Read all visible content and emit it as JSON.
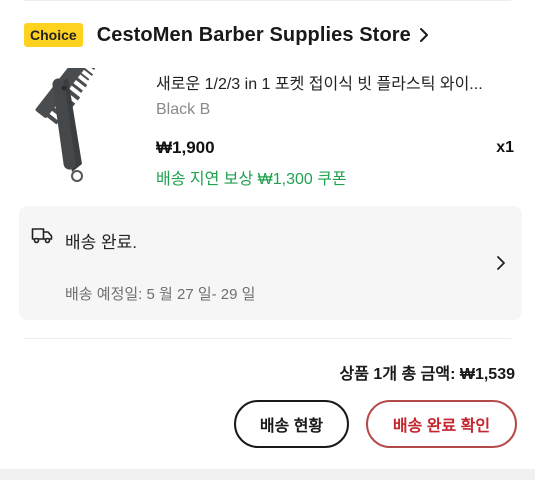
{
  "store": {
    "badge": "Choice",
    "name": "CestoMen Barber Supplies Store"
  },
  "product": {
    "title": "새로운 1/2/3 in 1 포켓 접이식 빗 플라스틱 와이...",
    "variant": "Black B",
    "price": "₩1,900",
    "quantity": "x1",
    "coupon": "배송 지연 보상 ₩1,300 쿠폰",
    "image_icon": "folding-comb-image"
  },
  "shipping": {
    "status": "배송 완료.",
    "eta": "배송 예정일: 5 월 27 일- 29 일",
    "icon": "truck-icon"
  },
  "summary": {
    "total": "상품 1개 총 금액: ₩1,539"
  },
  "actions": {
    "track_label": "배송 현황",
    "confirm_label": "배송 완료 확인"
  },
  "colors": {
    "badge_bg": "#ffd21f",
    "coupon_green": "#21a150",
    "confirm_red": "#c4252f"
  }
}
